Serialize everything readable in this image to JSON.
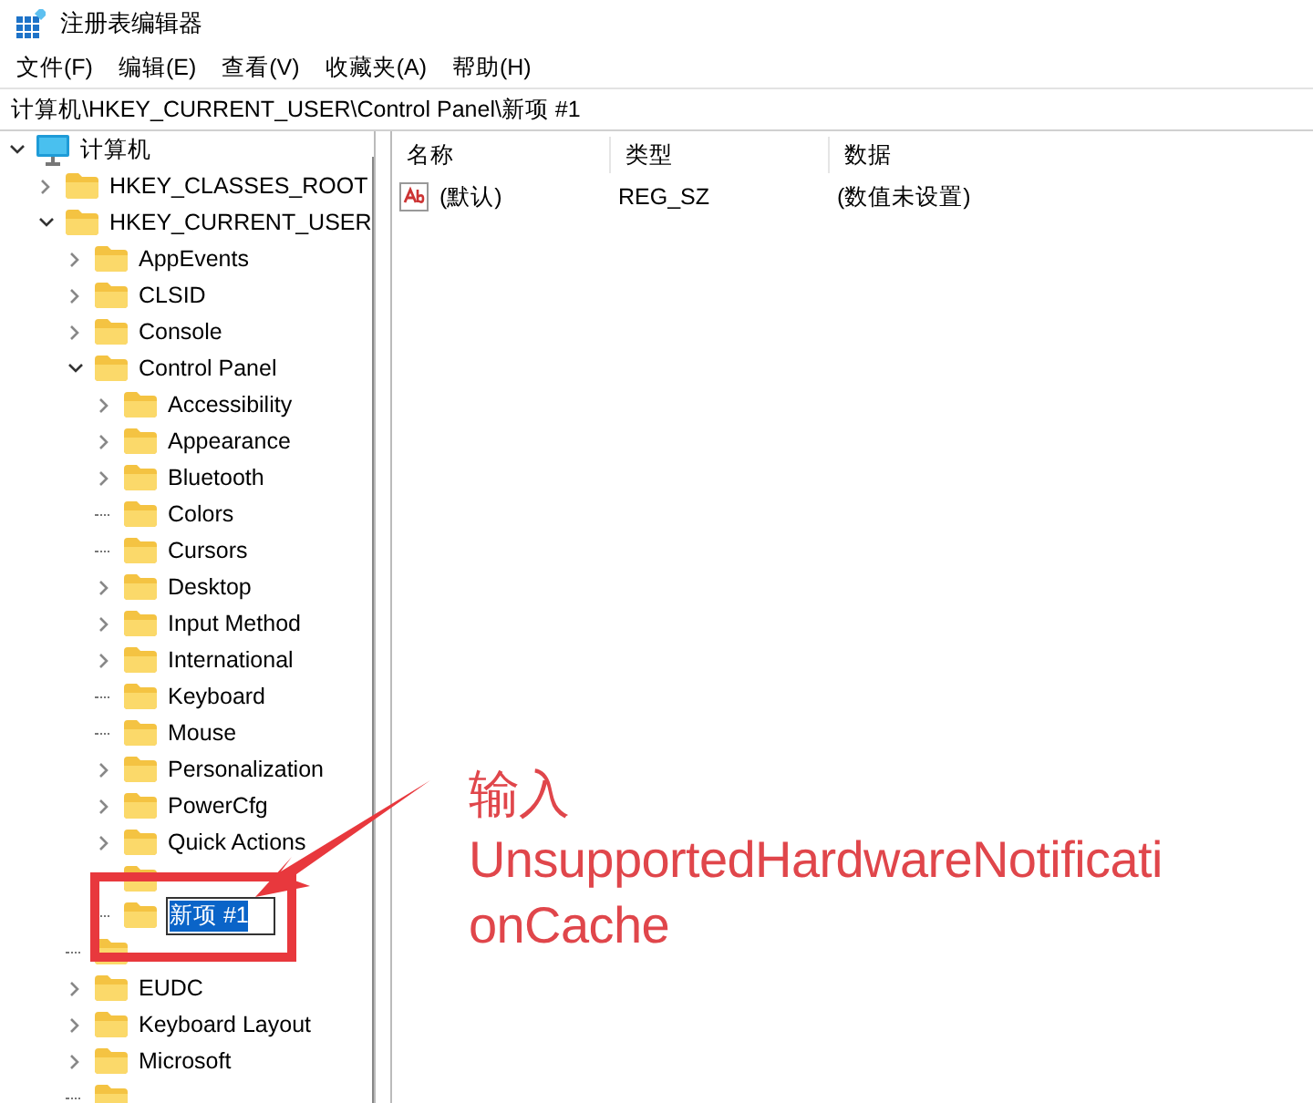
{
  "window": {
    "title": "注册表编辑器"
  },
  "menu": [
    {
      "label": "文件(F)"
    },
    {
      "label": "编辑(E)"
    },
    {
      "label": "查看(V)"
    },
    {
      "label": "收藏夹(A)"
    },
    {
      "label": "帮助(H)"
    }
  ],
  "address": "计算机\\HKEY_CURRENT_USER\\Control Panel\\新项 #1",
  "tree": {
    "label": "计算机",
    "kind": "computer",
    "expanded": true,
    "children": [
      {
        "label": "HKEY_CLASSES_ROOT",
        "kind": "folder",
        "expanded": false
      },
      {
        "label": "HKEY_CURRENT_USER",
        "kind": "folder",
        "expanded": true,
        "children": [
          {
            "label": "AppEvents",
            "kind": "folder",
            "expanded": false
          },
          {
            "label": "CLSID",
            "kind": "folder",
            "expanded": false
          },
          {
            "label": "Console",
            "kind": "folder",
            "expanded": false
          },
          {
            "label": "Control Panel",
            "kind": "folder",
            "expanded": true,
            "children": [
              {
                "label": "Accessibility",
                "kind": "folder",
                "expanded": false
              },
              {
                "label": "Appearance",
                "kind": "folder",
                "expanded": false
              },
              {
                "label": "Bluetooth",
                "kind": "folder",
                "expanded": false
              },
              {
                "label": "Colors",
                "kind": "leaf"
              },
              {
                "label": "Cursors",
                "kind": "leaf"
              },
              {
                "label": "Desktop",
                "kind": "folder",
                "expanded": false
              },
              {
                "label": "Input Method",
                "kind": "folder",
                "expanded": false
              },
              {
                "label": "International",
                "kind": "folder",
                "expanded": false
              },
              {
                "label": "Keyboard",
                "kind": "leaf"
              },
              {
                "label": "Mouse",
                "kind": "leaf"
              },
              {
                "label": "Personalization",
                "kind": "folder",
                "expanded": false
              },
              {
                "label": "PowerCfg",
                "kind": "folder",
                "expanded": false
              },
              {
                "label": "Quick Actions",
                "kind": "folder",
                "expanded": false
              },
              {
                "kind": "obscured"
              },
              {
                "label": "新项 #1",
                "kind": "editing"
              }
            ]
          },
          {
            "kind": "obscured"
          },
          {
            "label": "EUDC",
            "kind": "folder",
            "expanded": false
          },
          {
            "label": "Keyboard Layout",
            "kind": "folder",
            "expanded": false
          },
          {
            "label": "Microsoft",
            "kind": "folder",
            "expanded": false
          },
          {
            "kind": "obscured"
          }
        ]
      }
    ]
  },
  "list": {
    "columns": [
      "名称",
      "类型",
      "数据"
    ],
    "rows": [
      {
        "kind": "string",
        "name": "(默认)",
        "type": "REG_SZ",
        "data": "(数值未设置)"
      }
    ]
  },
  "annotation": {
    "lines": [
      "输入",
      "UnsupportedHardwareNotificati",
      "onCache"
    ]
  }
}
